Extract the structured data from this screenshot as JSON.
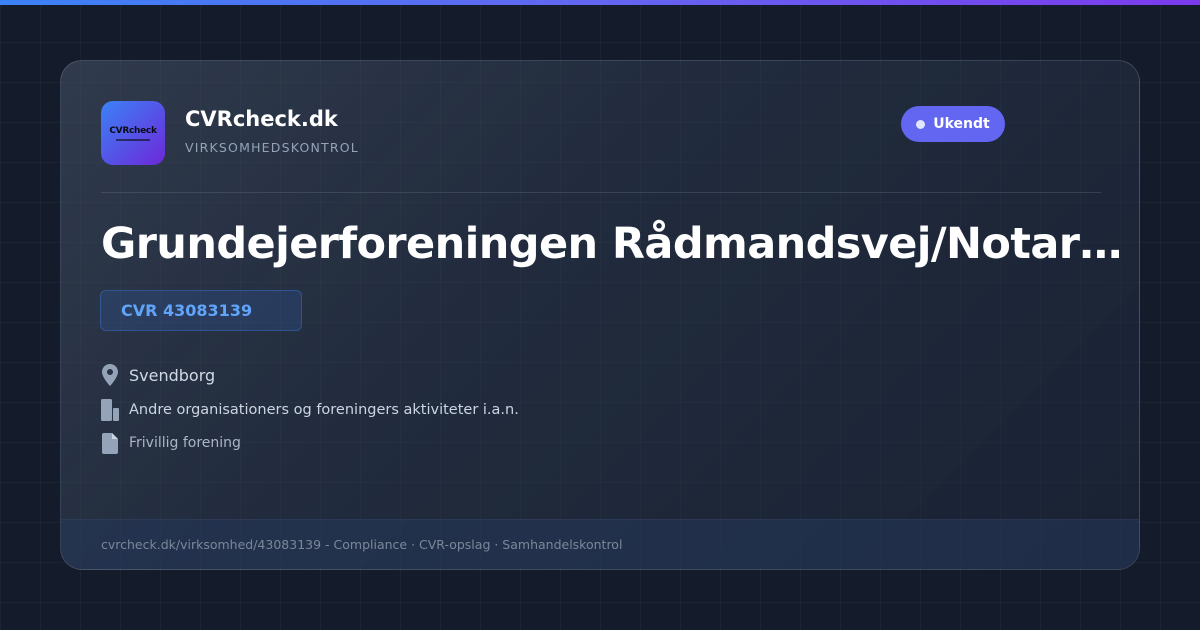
{
  "brand": {
    "logo_text": "CVRcheck",
    "name": "CVRcheck.dk",
    "tagline": "VIRKSOMHEDSKONTROL",
    "accent_color": "#6366f1"
  },
  "status": {
    "label": "Ukendt",
    "color": "#6366f1"
  },
  "company": {
    "name": "Grundejerforeningen Rådmandsvej/Notarvej",
    "cvr": "CVR 43083139",
    "city": "Svendborg",
    "industry": "Andre organisationers og foreningers aktiviteter i.a.n.",
    "company_type": "Frivillig forening"
  },
  "icons": {
    "city": "location-pin-icon",
    "industry": "building-icon",
    "company_type": "document-icon"
  },
  "footer": {
    "text": "cvrcheck.dk/virksomhed/43083139 - Compliance · CVR-opslag · Samhandelskontrol"
  }
}
